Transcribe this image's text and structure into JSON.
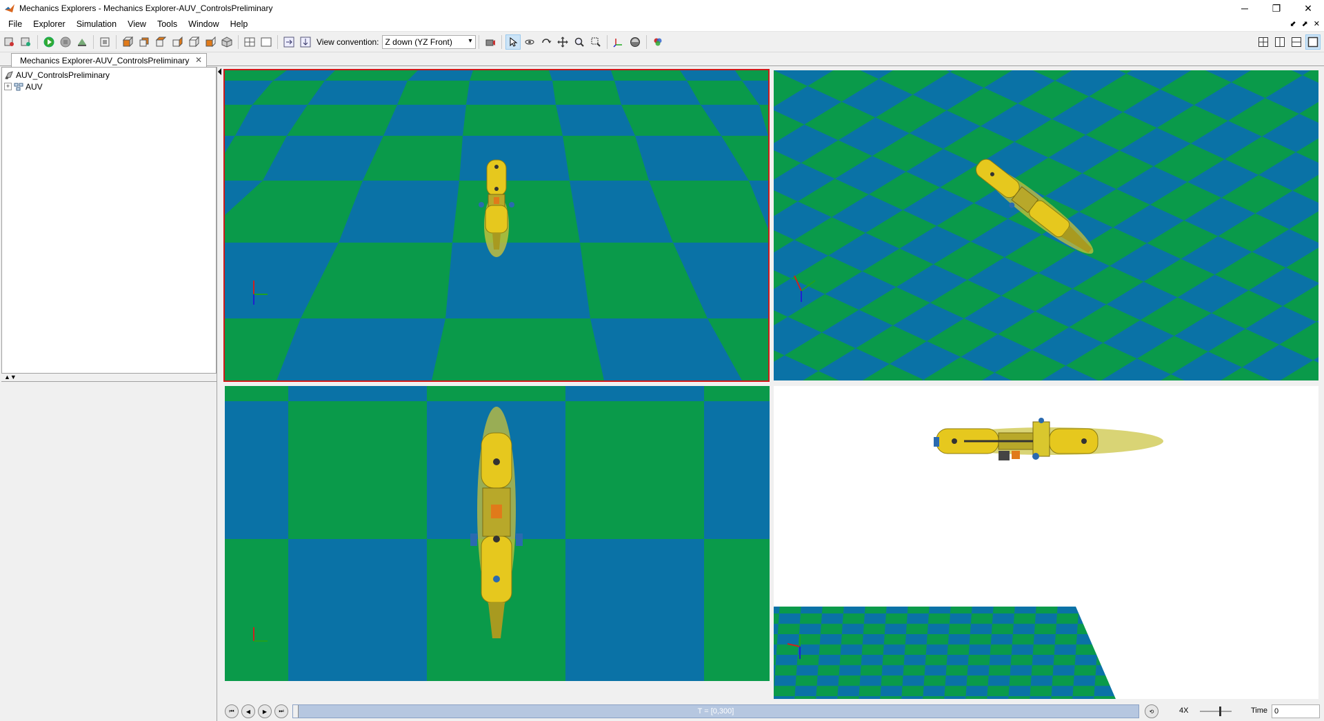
{
  "window": {
    "title": "Mechanics Explorers - Mechanics Explorer-AUV_ControlsPreliminary",
    "minimize": "─",
    "restore": "❐",
    "close": "✕"
  },
  "menu": {
    "items": [
      "File",
      "Explorer",
      "Simulation",
      "View",
      "Tools",
      "Window",
      "Help"
    ],
    "right_controls": [
      "⬋",
      "⬈",
      "✕"
    ]
  },
  "toolbar": {
    "view_convention_label": "View convention:",
    "view_convention_value": "Z down (YZ Front)"
  },
  "tab": {
    "label": "Mechanics Explorer-AUV_ControlsPreliminary",
    "close": "✕"
  },
  "tree": {
    "root": "AUV_ControlsPreliminary",
    "child": "AUV"
  },
  "splitter_arrows": "▲▼",
  "playback": {
    "timeline_label": "T = [0,300]",
    "speed": "4X",
    "time_label": "Time",
    "time_value": "0"
  },
  "colors": {
    "ground_green": "#0a9a4a",
    "ground_blue": "#0a72a6",
    "vehicle_yellow": "#e6c81e",
    "selected_border": "#d01818"
  }
}
